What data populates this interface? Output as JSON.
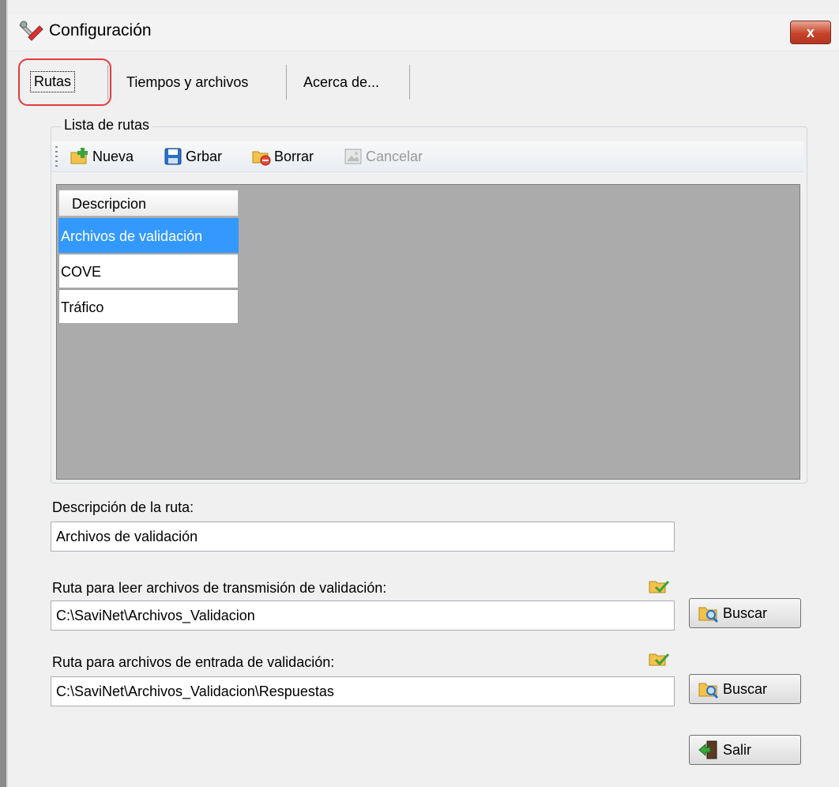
{
  "window": {
    "title": "Configuración",
    "icon": "tools-icon",
    "close_label": "x"
  },
  "tabs": [
    {
      "label": "Rutas",
      "active": true
    },
    {
      "label": "Tiempos y archivos",
      "active": false
    },
    {
      "label": "Acerca de...",
      "active": false
    }
  ],
  "routes_group": {
    "legend": "Lista de rutas",
    "toolbar": {
      "new_label": "Nueva",
      "save_label": "Grbar",
      "delete_label": "Borrar",
      "cancel_label": "Cancelar"
    },
    "grid": {
      "header": "Descripcion",
      "rows": [
        "Archivos de validación",
        "COVE",
        "Tráfico"
      ],
      "selected_index": 0
    }
  },
  "form": {
    "description_label": "Descripción de la ruta:",
    "description_value": "Archivos de validación",
    "read_path_label": "Ruta para leer archivos de transmisión de validación:",
    "read_path_value": "C:\\SaviNet\\Archivos_Validacion",
    "input_path_label": "Ruta para archivos de entrada de validación:",
    "input_path_value": "C:\\SaviNet\\Archivos_Validacion\\Respuestas",
    "browse_label": "Buscar",
    "exit_label": "Salir"
  },
  "colors": {
    "selection": "#3399ff",
    "close_button": "#c7432b",
    "highlight_ring": "#e63a3a"
  }
}
